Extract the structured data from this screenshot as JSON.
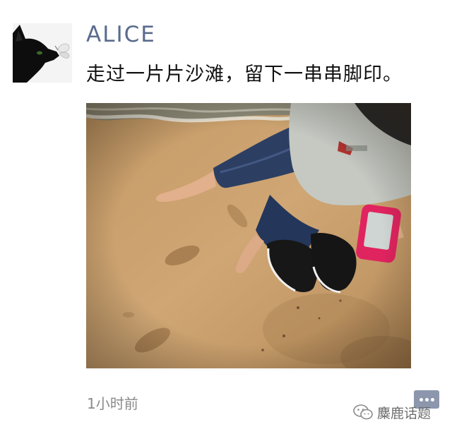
{
  "post": {
    "username": "ALICE",
    "text": "走过一片片沙滩，留下一串串脚印。",
    "timestamp": "1小时前"
  },
  "watermark": {
    "text": "麋鹿话题"
  },
  "icons": {
    "avatar": "black-cat-with-butterfly",
    "more": "more-dots-icon",
    "watermark": "wechat-logo-icon"
  },
  "colors": {
    "username": "#5a6b8c",
    "timestamp": "#8a8a8a",
    "more_button": "#8c97ad",
    "sand": "#c9a270"
  }
}
